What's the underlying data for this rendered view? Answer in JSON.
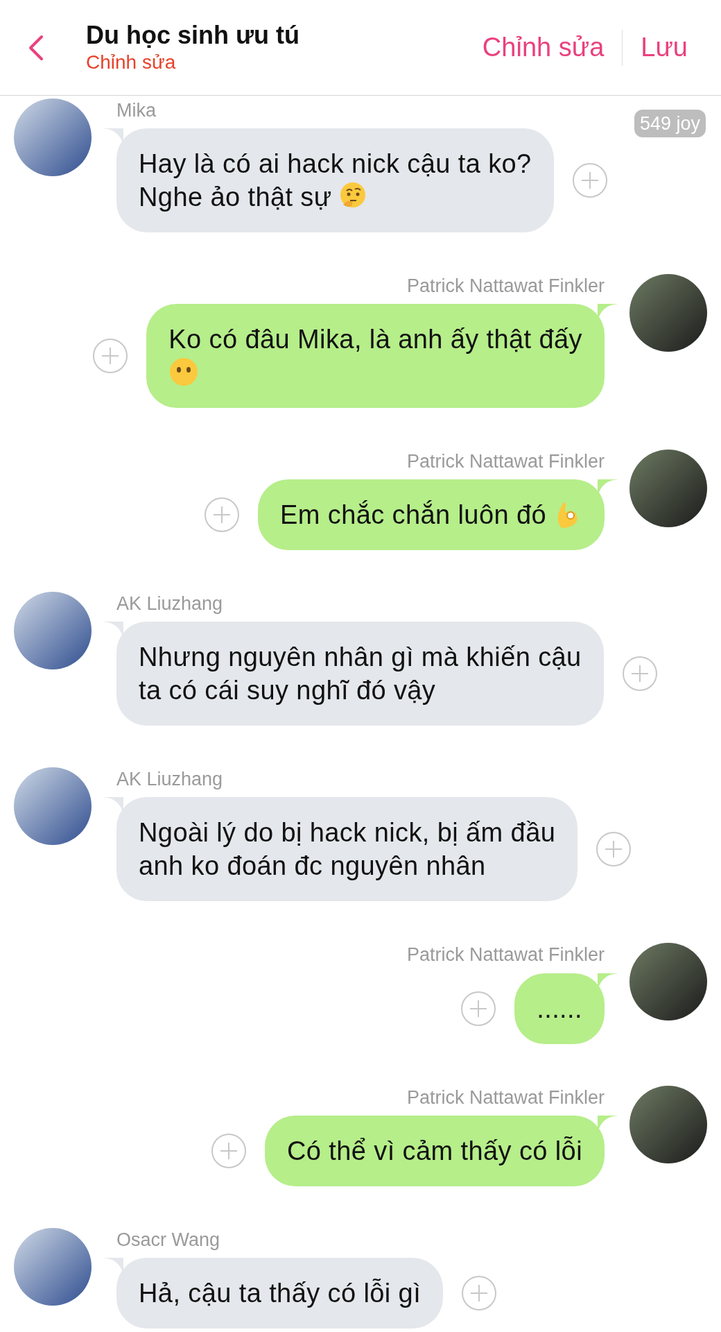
{
  "header": {
    "title": "Du học sinh ưu tú",
    "subtitle": "Chỉnh sửa",
    "actions": [
      "Chỉnh sửa",
      "Lưu"
    ]
  },
  "messages": [
    {
      "kind": "incoming",
      "sender": "Mika",
      "lines": [
        "Hay là có ai hack nick cậu ta ko?",
        "Nghe ảo thật sự"
      ],
      "emoji": {
        "kind": "thinking"
      },
      "badge": "549 joy"
    },
    {
      "kind": "outgoing",
      "sender": "Patrick Nattawat Finkler",
      "lines": [
        "Ko có đâu Mika, là anh ấy thật đấy"
      ],
      "emoji": {
        "kind": "neutral"
      }
    },
    {
      "kind": "outgoing",
      "sender": "Patrick Nattawat Finkler",
      "lines": [
        "Em chắc chắn luôn đó"
      ],
      "emoji": {
        "kind": "ok"
      }
    },
    {
      "kind": "incoming",
      "sender": "AK Liuzhang",
      "lines": [
        "Nhưng nguyên nhân gì mà khiến cậu",
        "ta có cái suy nghĩ đó vậy"
      ]
    },
    {
      "kind": "incoming",
      "sender": "AK Liuzhang",
      "lines": [
        "Ngoài lý do bị hack nick, bị ấm đầu",
        "anh ko đoán đc nguyên nhân"
      ]
    },
    {
      "kind": "outgoing",
      "sender": "Patrick Nattawat Finkler",
      "lines": [
        "......"
      ]
    },
    {
      "kind": "outgoing",
      "sender": "Patrick Nattawat Finkler",
      "lines": [
        "Có thể vì cảm thấy có lỗi"
      ]
    },
    {
      "kind": "incoming",
      "sender": "Osacr Wang",
      "lines": [
        "Hả, cậu ta thấy có lỗi gì"
      ]
    }
  ]
}
